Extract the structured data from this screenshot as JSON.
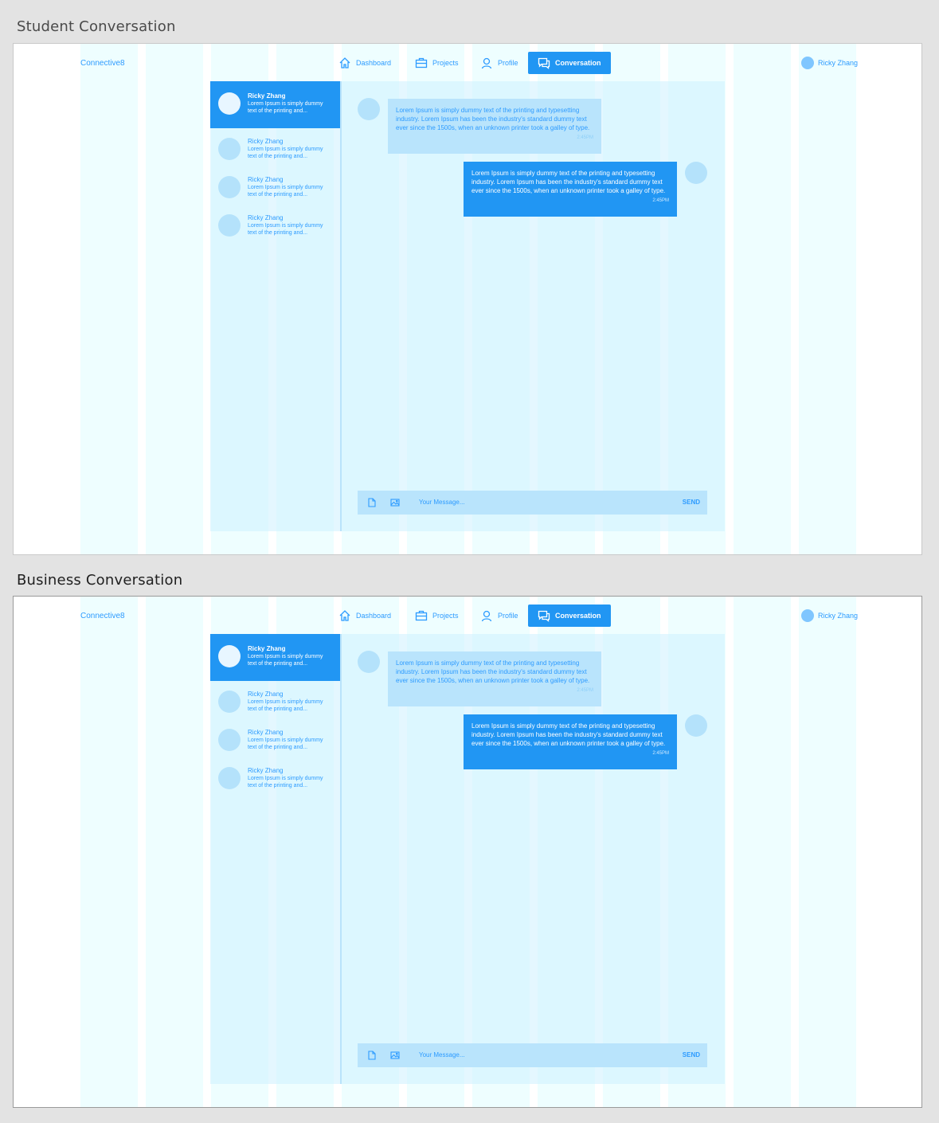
{
  "artboards": [
    {
      "title": "Student Conversation",
      "logo": "Connective8",
      "nav": [
        "Dashboard",
        "Projects",
        "Profile",
        "Conversation"
      ],
      "user_name": "Ricky Zhang",
      "conversations": [
        {
          "name": "Ricky Zhang",
          "preview_line1": "Lorem Ipsum is simply dummy",
          "preview_line2": "text of the printing and...",
          "active": true
        },
        {
          "name": "Ricky Zhang",
          "preview_line1": "Lorem Ipsum is simply dummy",
          "preview_line2": "text of the printing and...",
          "active": false
        },
        {
          "name": "Ricky Zhang",
          "preview_line1": "Lorem Ipsum is simply dummy",
          "preview_line2": "text of the printing and...",
          "active": false
        },
        {
          "name": "Ricky Zhang",
          "preview_line1": "Lorem Ipsum is simply dummy",
          "preview_line2": "text of the printing and...",
          "active": false
        }
      ],
      "messages": [
        {
          "direction": "in",
          "text": "Lorem Ipsum is simply dummy text of the printing and typesetting industry. Lorem Ipsum has been the industry's standard dummy text ever since the 1500s, when an unknown printer took a galley of type.",
          "time": "2:45PM"
        },
        {
          "direction": "out",
          "text": "Lorem Ipsum is simply dummy text of the printing and typesetting industry. Lorem Ipsum has been the industry's standard dummy text ever since the 1500s, when an unknown printer took a galley of type.",
          "time": "2:45PM"
        }
      ],
      "composer": {
        "placeholder": "Your Message...",
        "send_label": "SEND"
      }
    },
    {
      "title": "Business Conversation",
      "logo": "Connective8",
      "nav": [
        "Dashboard",
        "Projects",
        "Profile",
        "Conversation"
      ],
      "user_name": "Ricky Zhang",
      "conversations": [
        {
          "name": "Ricky Zhang",
          "preview_line1": "Lorem Ipsum is simply dummy",
          "preview_line2": "text of the printing and...",
          "active": true
        },
        {
          "name": "Ricky Zhang",
          "preview_line1": "Lorem Ipsum is simply dummy",
          "preview_line2": "text of the printing and...",
          "active": false
        },
        {
          "name": "Ricky Zhang",
          "preview_line1": "Lorem Ipsum is simply dummy",
          "preview_line2": "text of the printing and...",
          "active": false
        },
        {
          "name": "Ricky Zhang",
          "preview_line1": "Lorem Ipsum is simply dummy",
          "preview_line2": "text of the printing and...",
          "active": false
        }
      ],
      "messages": [
        {
          "direction": "in",
          "text": "Lorem Ipsum is simply dummy text of the printing and typesetting industry. Lorem Ipsum has been the industry's standard dummy text ever since the 1500s, when an unknown printer took a galley of type.",
          "time": "2:45PM"
        },
        {
          "direction": "out",
          "text": "Lorem Ipsum is simply dummy text of the printing and typesetting industry. Lorem Ipsum has been the industry's standard dummy text ever since the 1500s, when an unknown printer took a galley of type.",
          "time": "2:45PM"
        }
      ],
      "composer": {
        "placeholder": "Your Message...",
        "send_label": "SEND"
      }
    }
  ],
  "colors": {
    "accent": "#2196f3",
    "light_accent": "#b9e4fc",
    "grid_column": "#eefeff",
    "page_background": "#e3e3e3"
  },
  "icons": {
    "nav": [
      "home-icon",
      "briefcase-icon",
      "user-icon",
      "chat-icon"
    ],
    "composer": [
      "file-icon",
      "image-icon"
    ]
  }
}
